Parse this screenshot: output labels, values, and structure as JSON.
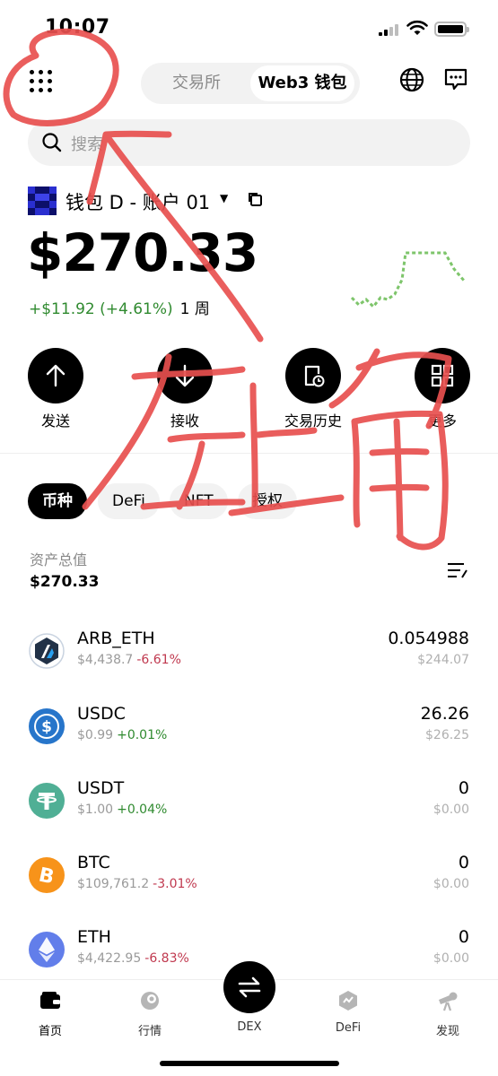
{
  "status": {
    "time": "10:07"
  },
  "nav": {
    "tab_exchange": "交易所",
    "tab_wallet": "Web3 钱包"
  },
  "search": {
    "placeholder": "搜索"
  },
  "account": {
    "name": "钱包 D - 账户 01"
  },
  "balance": {
    "total": "$270.33",
    "change": "+$11.92 (+4.61%)",
    "period": "1 周"
  },
  "actions": [
    {
      "label": "发送",
      "icon": "arrow-up-icon"
    },
    {
      "label": "接收",
      "icon": "arrow-down-icon"
    },
    {
      "label": "交易历史",
      "icon": "history-icon"
    },
    {
      "label": "更多",
      "icon": "grid-icon"
    }
  ],
  "chips": [
    "币种",
    "DeFi",
    "NFT",
    "授权"
  ],
  "assets_summary": {
    "label": "资产总值",
    "value": "$270.33"
  },
  "assets": [
    {
      "symbol": "ARB_ETH",
      "price": "$4,438.7",
      "change": "-6.61%",
      "amount": "0.054988",
      "value": "$244.07",
      "color": "#213147"
    },
    {
      "symbol": "USDC",
      "price": "$0.99",
      "change": "+0.01%",
      "amount": "26.26",
      "value": "$26.25",
      "color": "#2775ca"
    },
    {
      "symbol": "USDT",
      "price": "$1.00",
      "change": "+0.04%",
      "amount": "0",
      "value": "$0.00",
      "color": "#50af95"
    },
    {
      "symbol": "BTC",
      "price": "$109,761.2",
      "change": "-3.01%",
      "amount": "0",
      "value": "$0.00",
      "color": "#f7931a"
    },
    {
      "symbol": "ETH",
      "price": "$4,422.95",
      "change": "-6.83%",
      "amount": "0",
      "value": "$0.00",
      "color": "#627eea"
    }
  ],
  "tabbar": {
    "home": "首页",
    "market": "行情",
    "dex": "DEX",
    "defi": "DeFi",
    "discover": "发现"
  },
  "annotation": {
    "text": "左上角",
    "color": "#e8504f"
  }
}
